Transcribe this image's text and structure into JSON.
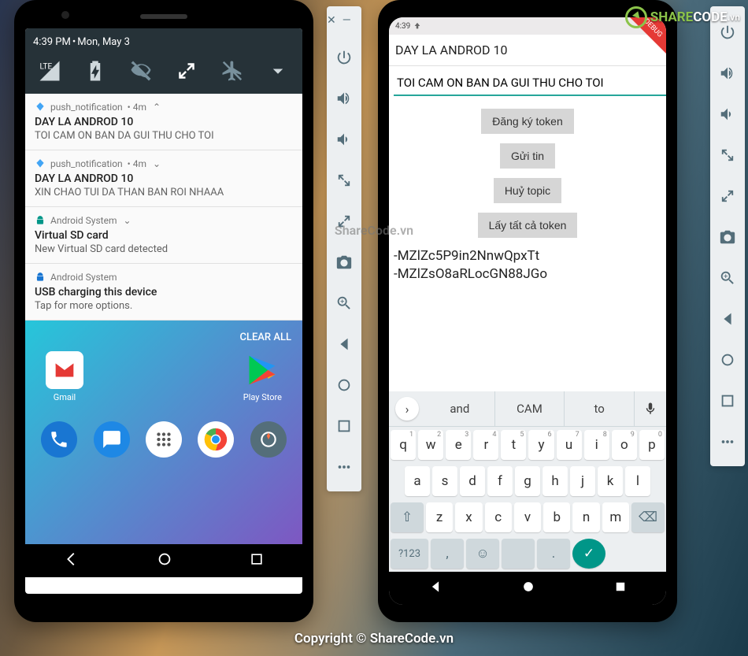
{
  "watermark_center": "Copyright © ShareCode.vn",
  "watermark_mid": "ShareCode.vn",
  "logo_text_share": "SHARE",
  "logo_text_code": "CODE",
  "logo_text_vn": ".vn",
  "sidebar_icons": [
    "power",
    "volume-up",
    "volume-down",
    "rotate-left",
    "rotate-right",
    "camera",
    "zoom",
    "back",
    "home",
    "overview",
    "more"
  ],
  "left_phone": {
    "status": {
      "time": "4:39 PM",
      "sep": " • ",
      "date": "Mon, May 3"
    },
    "qs": [
      "lte-signal",
      "battery-charging",
      "eye-off",
      "auto-rotate",
      "airplane-off",
      "expand"
    ],
    "notifications": [
      {
        "icon": "flutter",
        "source": "push_notification",
        "age": "4m",
        "chev": "up",
        "title": "DAY LA ANDROD 10",
        "body": "TOI CAM ON BAN DA GUI THU CHO TOI"
      },
      {
        "icon": "flutter",
        "source": "push_notification",
        "age": "4m",
        "chev": "down",
        "title": "DAY LA ANDROD 10",
        "body": "XIN CHAO TUI DA THAN BAN ROI NHAAA"
      },
      {
        "icon": "android",
        "source": "Android System",
        "chev": "down",
        "title": "Virtual SD card",
        "body": "New Virtual SD card detected"
      },
      {
        "icon": "android-blue",
        "source": "Android System",
        "title": "USB charging this device",
        "body": "Tap for more options."
      }
    ],
    "clear_all": "CLEAR ALL",
    "apps": [
      {
        "name": "Gmail"
      },
      {
        "name": "Play Store"
      }
    ],
    "dock": [
      "phone",
      "messages",
      "apps",
      "chrome",
      "camera"
    ]
  },
  "right_phone": {
    "status_time": "4:39",
    "debug_label": "DEBUG",
    "appbar_title": "DAY LA ANDROD 10",
    "input_value": "TOI CAM ON BAN DA GUI THU CHO TOI",
    "buttons": [
      "Đăng ký token",
      "Gửi tin",
      "Huỷ topic",
      "Lấy tất cả token"
    ],
    "token_lines": [
      "-MZlZc5P9in2NnwQpxTt",
      "-MZlZsO8aRLocGN88JGo"
    ],
    "suggestions": {
      "chip": "›",
      "items": [
        "and",
        "CAM",
        "to"
      ]
    },
    "key_rows": [
      [
        [
          "q",
          "1"
        ],
        [
          "w",
          "2"
        ],
        [
          "e",
          "3"
        ],
        [
          "r",
          "4"
        ],
        [
          "t",
          "5"
        ],
        [
          "y",
          "6"
        ],
        [
          "u",
          "7"
        ],
        [
          "i",
          "8"
        ],
        [
          "o",
          "9"
        ],
        [
          "p",
          "0"
        ]
      ],
      [
        [
          "a",
          ""
        ],
        [
          "s",
          ""
        ],
        [
          "d",
          ""
        ],
        [
          "f",
          ""
        ],
        [
          "g",
          ""
        ],
        [
          "h",
          ""
        ],
        [
          "j",
          ""
        ],
        [
          "k",
          ""
        ],
        [
          "l",
          ""
        ]
      ],
      [
        [
          "z",
          ""
        ],
        [
          "x",
          ""
        ],
        [
          "c",
          ""
        ],
        [
          "v",
          ""
        ],
        [
          "b",
          ""
        ],
        [
          "n",
          ""
        ],
        [
          "m",
          ""
        ]
      ]
    ],
    "fn": {
      "shift": "⇧",
      "bksp": "⌫",
      "num": "?123",
      "comma": ",",
      "emoji": "☺",
      "period": ".",
      "enter": "✓"
    }
  }
}
